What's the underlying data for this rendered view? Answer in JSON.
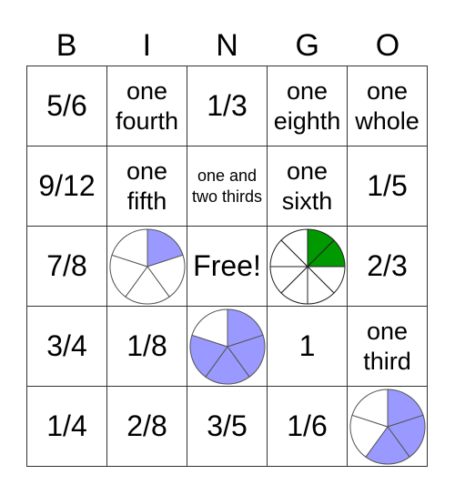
{
  "header": [
    "B",
    "I",
    "N",
    "G",
    "O"
  ],
  "colors": {
    "blue": "#9999ff",
    "green": "#009900"
  },
  "cells": [
    {
      "type": "text",
      "text": "5/6",
      "size": "lg"
    },
    {
      "type": "text",
      "text": "one fourth",
      "size": "md"
    },
    {
      "type": "text",
      "text": "1/3",
      "size": "lg"
    },
    {
      "type": "text",
      "text": "one eighth",
      "size": "md"
    },
    {
      "type": "text",
      "text": "one whole",
      "size": "md"
    },
    {
      "type": "text",
      "text": "9/12",
      "size": "lg"
    },
    {
      "type": "text",
      "text": "one fifth",
      "size": "md"
    },
    {
      "type": "text",
      "text": "one and two thirds",
      "size": "sm"
    },
    {
      "type": "text",
      "text": "one sixth",
      "size": "md"
    },
    {
      "type": "text",
      "text": "1/5",
      "size": "lg"
    },
    {
      "type": "text",
      "text": "7/8",
      "size": "lg"
    },
    {
      "type": "pie",
      "slices": 5,
      "filled": 1,
      "color": "blue",
      "label": "1/5 pie"
    },
    {
      "type": "text",
      "text": "Free!",
      "size": "lg",
      "free": true
    },
    {
      "type": "pie",
      "slices": 8,
      "filled": 2,
      "color": "green",
      "label": "2/8 pie"
    },
    {
      "type": "text",
      "text": "2/3",
      "size": "lg"
    },
    {
      "type": "text",
      "text": "3/4",
      "size": "lg"
    },
    {
      "type": "text",
      "text": "1/8",
      "size": "lg"
    },
    {
      "type": "pie",
      "slices": 5,
      "filled": 4,
      "color": "blue",
      "label": "4/5 pie"
    },
    {
      "type": "text",
      "text": "1",
      "size": "lg"
    },
    {
      "type": "text",
      "text": "one third",
      "size": "md"
    },
    {
      "type": "text",
      "text": "1/4",
      "size": "lg"
    },
    {
      "type": "text",
      "text": "2/8",
      "size": "lg"
    },
    {
      "type": "text",
      "text": "3/5",
      "size": "lg"
    },
    {
      "type": "text",
      "text": "1/6",
      "size": "lg"
    },
    {
      "type": "pie",
      "slices": 5,
      "filled": 3,
      "color": "blue",
      "label": "3/5 pie"
    }
  ]
}
